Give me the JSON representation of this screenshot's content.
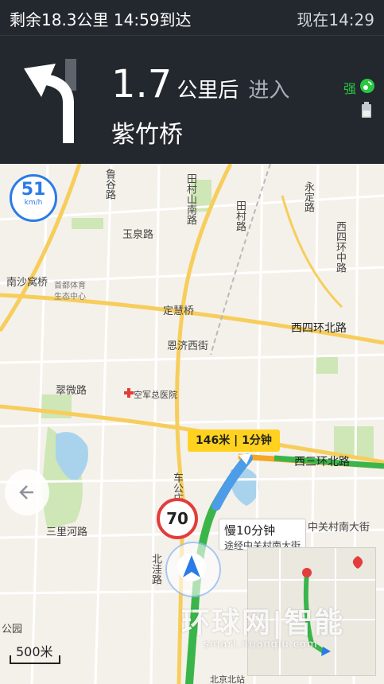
{
  "status": {
    "remaining": "剩余18.3公里  14:59到达",
    "now": "现在14:29"
  },
  "guidance": {
    "distance": "1.7",
    "unit": "公里后",
    "action": "进入",
    "road": "紫竹桥"
  },
  "signal": {
    "label": "强",
    "color": "#28c940"
  },
  "speed": {
    "value": "51",
    "unit": "km/h"
  },
  "speed_limit": "70",
  "traffic_tip": "146米 | 1分钟",
  "slow_tip": {
    "title": "慢10分钟",
    "detail": "途经中关村南大街"
  },
  "scale": "500米",
  "watermark": {
    "brand": "环球网|智能",
    "url": "smart.huanqiu.com"
  },
  "map_labels": [
    "玉泉路",
    "南沙窝桥",
    "定慧桥",
    "西四环北路",
    "恩济西街",
    "翠微路",
    "空军总医院",
    "西三环北路",
    "三里河路",
    "中关村南大街",
    "北京北站",
    "首都体育",
    "生态中心"
  ],
  "map_labels_vertical": [
    "田村山南路",
    "田村路",
    "鲁谷路",
    "车公庄",
    "北洼路",
    "永定路",
    "西四环中路",
    "公园"
  ],
  "colors": {
    "route": "#3ab54a",
    "accent": "#2a7be8",
    "traffic": "#ffd21f",
    "limit": "#e23c3c"
  }
}
